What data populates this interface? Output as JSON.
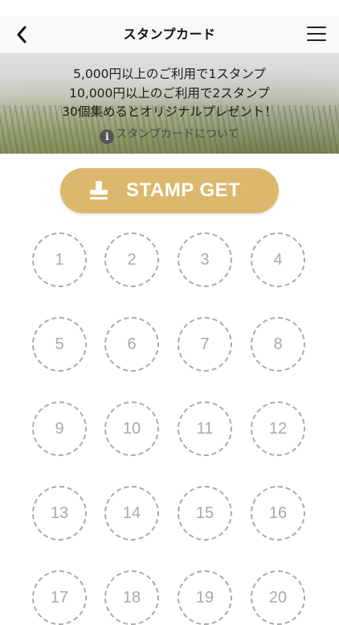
{
  "header": {
    "title": "スタンプカード",
    "back_icon": "chevron-left-icon",
    "menu_icon": "hamburger-menu-icon"
  },
  "banner": {
    "line1": "5,000円以上のご利用で1スタンプ",
    "line2": "10,000円以上のご利用で2スタンプ",
    "line3": "30個集めるとオリジナルプレゼント！",
    "about_link": "スタンプカードについて",
    "info_icon_glyph": "i"
  },
  "stamp_button": {
    "label": "STAMP GET",
    "color": "#dcb86c",
    "icon": "stamp-icon"
  },
  "stamps": [
    "1",
    "2",
    "3",
    "4",
    "5",
    "6",
    "7",
    "8",
    "9",
    "10",
    "11",
    "12",
    "13",
    "14",
    "15",
    "16",
    "17",
    "18",
    "19",
    "20"
  ]
}
